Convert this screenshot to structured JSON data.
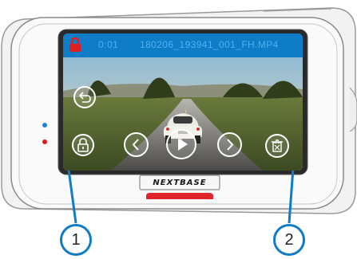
{
  "status_bar": {
    "time": "0:01",
    "filename": "180206_193941_001_FH.MP4",
    "protected": true
  },
  "brand": {
    "logo_text": "NEXTBASE"
  },
  "controls": {
    "back": {
      "icon": "back-arrow-icon"
    },
    "protect": {
      "icon": "lock-icon"
    },
    "previous": {
      "icon": "chevron-left-icon"
    },
    "play": {
      "icon": "play-icon"
    },
    "next": {
      "icon": "chevron-right-icon"
    },
    "delete": {
      "icon": "trash-icon"
    }
  },
  "callouts": {
    "left": "1",
    "right": "2"
  },
  "colors": {
    "accent": "#0f7cc8",
    "lock": "#e02020",
    "led_blue": "#1d7fd0",
    "led_red": "#e01818",
    "record_button": "#e0242c"
  }
}
